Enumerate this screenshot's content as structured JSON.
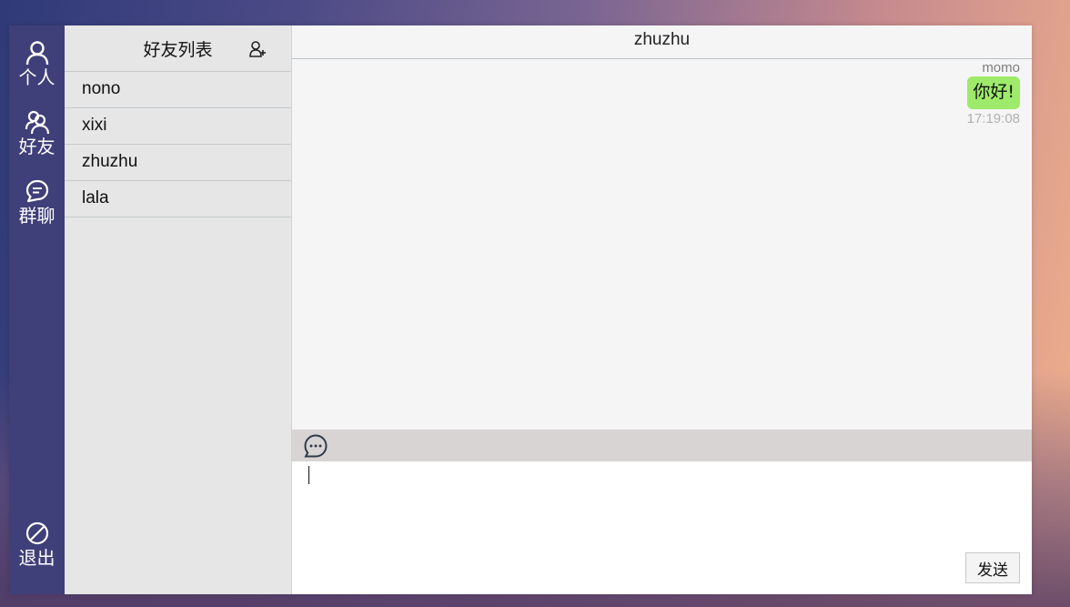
{
  "nav": {
    "profile_label": "个人",
    "friends_label": "好友",
    "groups_label": "群聊",
    "logout_label": "退出"
  },
  "friends": {
    "title": "好友列表",
    "items": [
      "nono",
      "xixi",
      "zhuzhu",
      "lala"
    ]
  },
  "chat": {
    "title": "zhuzhu",
    "messages": [
      {
        "sender": "momo",
        "text": "你好!",
        "time": "17:19:08"
      }
    ],
    "input_value": "",
    "send_label": "发送"
  },
  "colors": {
    "navbar": "#3f3f7a",
    "friend_panel": "#e6e6e6",
    "chat_bg": "#f5f5f5",
    "bubble": "#9eea6a",
    "toolbar": "#d8d4d4"
  },
  "icons": {
    "profile": "user-icon",
    "friends": "users-icon",
    "groups": "chat-bubble-icon",
    "logout": "ban-icon",
    "add_friend": "add-user-icon",
    "emoji": "more-chat-icon"
  }
}
